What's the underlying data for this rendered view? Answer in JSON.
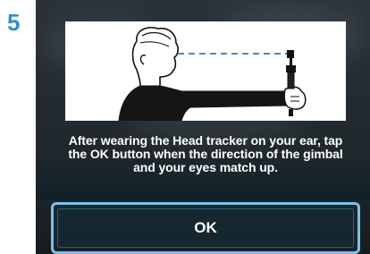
{
  "step": {
    "number": "5"
  },
  "dialog": {
    "message": "After wearing the Head tracker on your ear, tap the OK button when the direction of the gimbal and your eyes match up.",
    "ok_label": "OK",
    "illustration_icon": "person-holding-gimbal-illustration"
  },
  "colors": {
    "accent": "#2b91cf",
    "button_border": "#7cc0ea",
    "text": "#ffffff"
  }
}
